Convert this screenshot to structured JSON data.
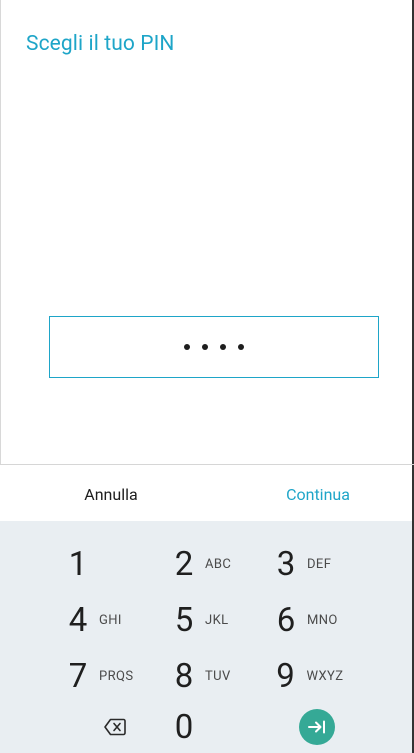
{
  "screen": {
    "title": "Scegli il tuo PIN"
  },
  "pin": {
    "dot_count": 4
  },
  "actions": {
    "cancel_label": "Annulla",
    "continue_label": "Continua"
  },
  "keypad": {
    "keys": [
      {
        "digit": "1",
        "letters": ""
      },
      {
        "digit": "2",
        "letters": "ABC"
      },
      {
        "digit": "3",
        "letters": "DEF"
      },
      {
        "digit": "4",
        "letters": "GHI"
      },
      {
        "digit": "5",
        "letters": "JKL"
      },
      {
        "digit": "6",
        "letters": "MNO"
      },
      {
        "digit": "7",
        "letters": "PRQS"
      },
      {
        "digit": "8",
        "letters": "TUV"
      },
      {
        "digit": "9",
        "letters": "WXYZ"
      }
    ],
    "zero_digit": "0",
    "backspace_icon": "backspace-icon",
    "enter_icon": "enter-arrow-icon"
  },
  "colors": {
    "accent": "#1ea5c8",
    "enter_button": "#35a996",
    "keypad_background": "#e9eef2"
  }
}
